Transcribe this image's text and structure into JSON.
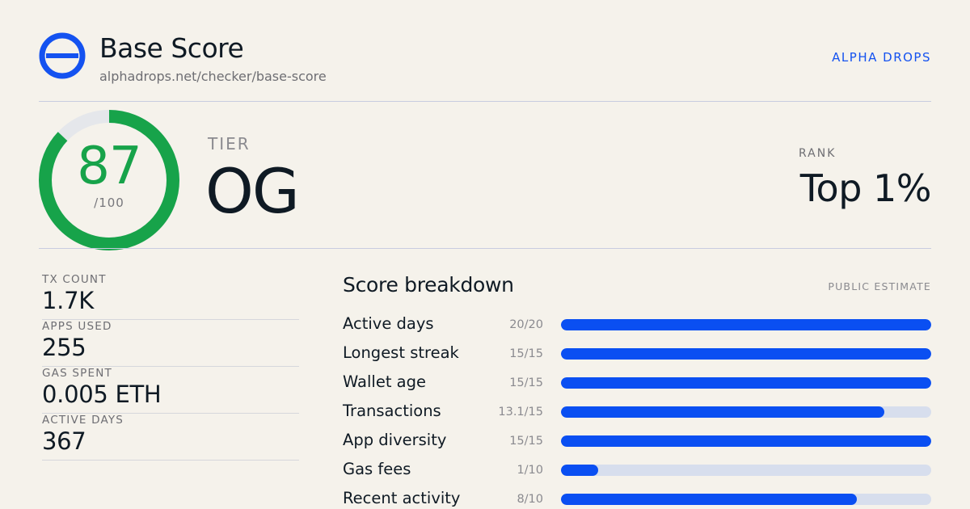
{
  "header": {
    "title": "Base Score",
    "url": "alphadrops.net/checker/base-score",
    "brand": "ALPHA DROPS",
    "logo_icon": "base-logo-icon",
    "logo_color": "#1452f0"
  },
  "score": {
    "value": "87",
    "max": "/100",
    "fraction": 0.87,
    "ring_color": "#17a34a"
  },
  "tier": {
    "label": "TIER",
    "value": "OG"
  },
  "rank": {
    "label": "RANK",
    "value": "Top 1%"
  },
  "stats": [
    {
      "label": "TX COUNT",
      "value": "1.7K"
    },
    {
      "label": "APPS USED",
      "value": "255"
    },
    {
      "label": "GAS SPENT",
      "value": "0.005 ETH"
    },
    {
      "label": "ACTIVE DAYS",
      "value": "367"
    }
  ],
  "breakdown": {
    "title": "Score breakdown",
    "note": "PUBLIC ESTIMATE",
    "bar_color": "#0a4ff2",
    "track_color": "#d7deed",
    "rows": [
      {
        "label": "Active days",
        "score": "20/20",
        "fraction": 1.0
      },
      {
        "label": "Longest streak",
        "score": "15/15",
        "fraction": 1.0
      },
      {
        "label": "Wallet age",
        "score": "15/15",
        "fraction": 1.0
      },
      {
        "label": "Transactions",
        "score": "13.1/15",
        "fraction": 0.873
      },
      {
        "label": "App diversity",
        "score": "15/15",
        "fraction": 1.0
      },
      {
        "label": "Gas fees",
        "score": "1/10",
        "fraction": 0.1
      },
      {
        "label": "Recent activity",
        "score": "8/10",
        "fraction": 0.8
      }
    ]
  }
}
